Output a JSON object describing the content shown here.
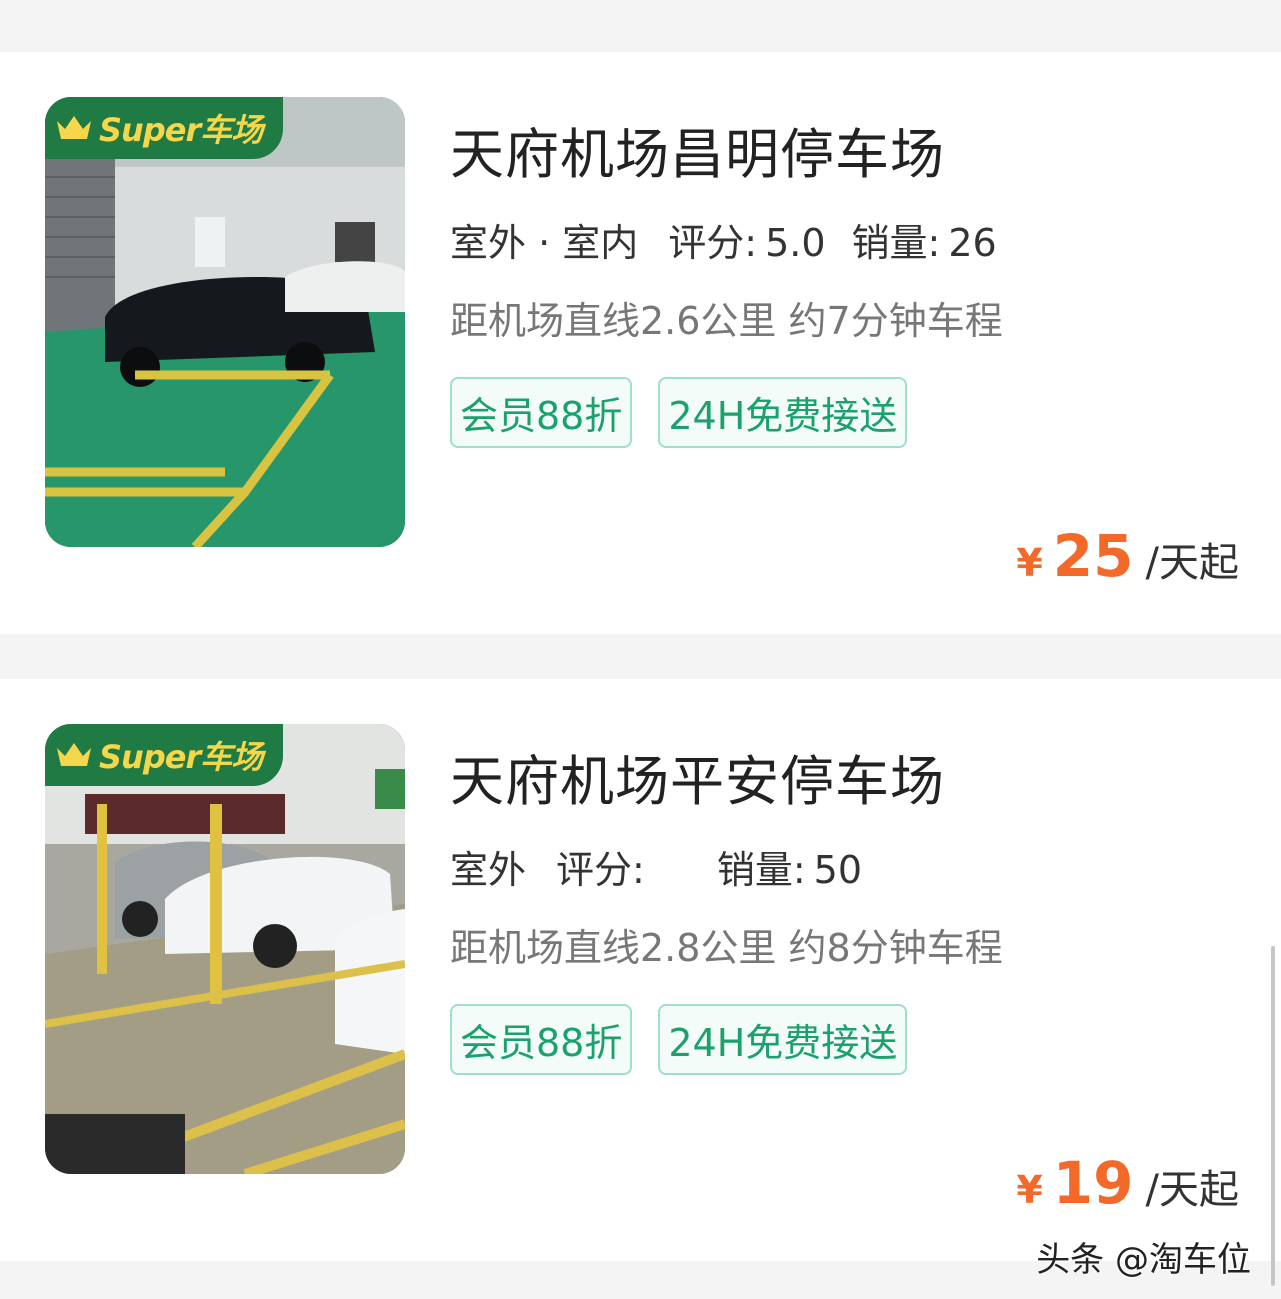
{
  "badge": {
    "text": "Super车场",
    "icon": "crown-icon"
  },
  "lots": [
    {
      "name": "天府机场昌明停车场",
      "type": "室外 · 室内",
      "rating_label": "评分:",
      "rating_value": "5.0",
      "sales_label": "销量:",
      "sales_value": "26",
      "distance": "距机场直线2.6公里 约7分钟车程",
      "tags": [
        "会员88折",
        "24H免费接送"
      ],
      "currency": "¥",
      "price": "25",
      "price_unit": "/天起"
    },
    {
      "name": "天府机场平安停车场",
      "type": "室外",
      "rating_label": "评分:",
      "rating_value": "",
      "sales_label": "销量:",
      "sales_value": "50",
      "distance": "距机场直线2.8公里 约8分钟车程",
      "tags": [
        "会员88折",
        "24H免费接送"
      ],
      "currency": "¥",
      "price": "19",
      "price_unit": "/天起"
    }
  ],
  "watermark": "头条 @淘车位",
  "colors": {
    "accent_green": "#1ba16c",
    "price_orange": "#f2692a",
    "badge_green": "#1f7a44",
    "badge_gold": "#f6d64a"
  }
}
